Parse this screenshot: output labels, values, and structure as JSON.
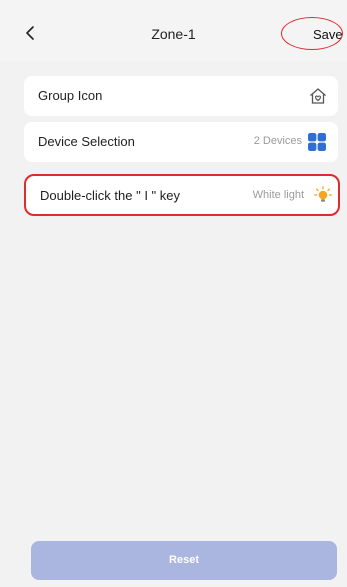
{
  "header": {
    "title": "Zone-1",
    "save_label": "Save"
  },
  "rows": [
    {
      "label": "Group Icon",
      "value": "",
      "icon": "home-heart-icon"
    },
    {
      "label": "Device Selection",
      "value": "2 Devices",
      "icon": "grid-devices-icon"
    },
    {
      "label": "Double-click the \" I \" key",
      "value": "White light",
      "icon": "light-bulb-icon"
    }
  ],
  "reset_label": "Reset",
  "colors": {
    "highlight": "#e02a2f",
    "reset_bg": "#aab5e0",
    "device_icon": "#2f6ed3",
    "bulb": "#f5a623"
  }
}
